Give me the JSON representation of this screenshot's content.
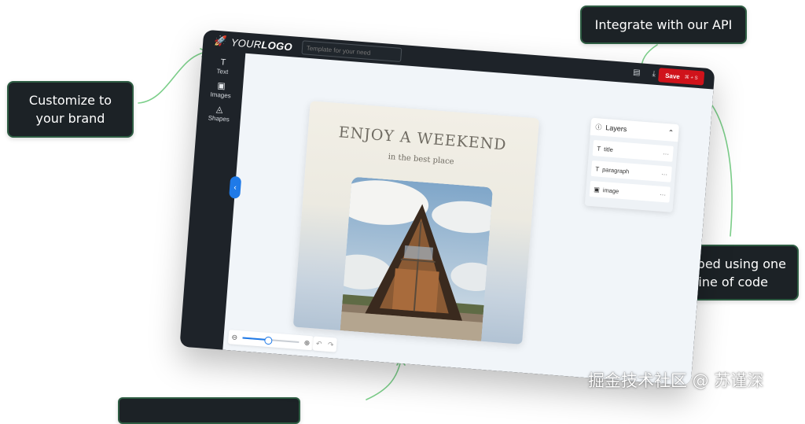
{
  "callouts": {
    "api": "Integrate with our API",
    "brand_line1": "Customize to",
    "brand_line2": "your brand",
    "embed_line1": "Embed using one",
    "embed_line2": "line of code"
  },
  "editor": {
    "logo_prefix": "YOUR",
    "logo_bold": "LOGO",
    "template_placeholder": "Template for your need",
    "save_label": "Save",
    "save_shortcut": "⌘ + S",
    "sidebar": [
      {
        "icon": "text-icon",
        "label": "Text"
      },
      {
        "icon": "image-icon",
        "label": "Images"
      },
      {
        "icon": "shapes-icon",
        "label": "Shapes"
      }
    ],
    "card": {
      "title": "ENJOY A WEEKEND",
      "subtitle": "in the best place"
    },
    "layers": {
      "header": "Layers",
      "items": [
        {
          "icon": "text-icon",
          "label": "title"
        },
        {
          "icon": "text-icon",
          "label": "paragraph"
        },
        {
          "icon": "image-icon",
          "label": "image"
        }
      ]
    },
    "zoom_level": 0.45
  },
  "watermark": "掘金技术社区 @ 苏谨深",
  "colors": {
    "accent": "#1f7ae8",
    "save": "#d0131b",
    "callout_bg": "#1c2226",
    "callout_border": "#2e5d43",
    "arrow": "#7ccf8a"
  }
}
